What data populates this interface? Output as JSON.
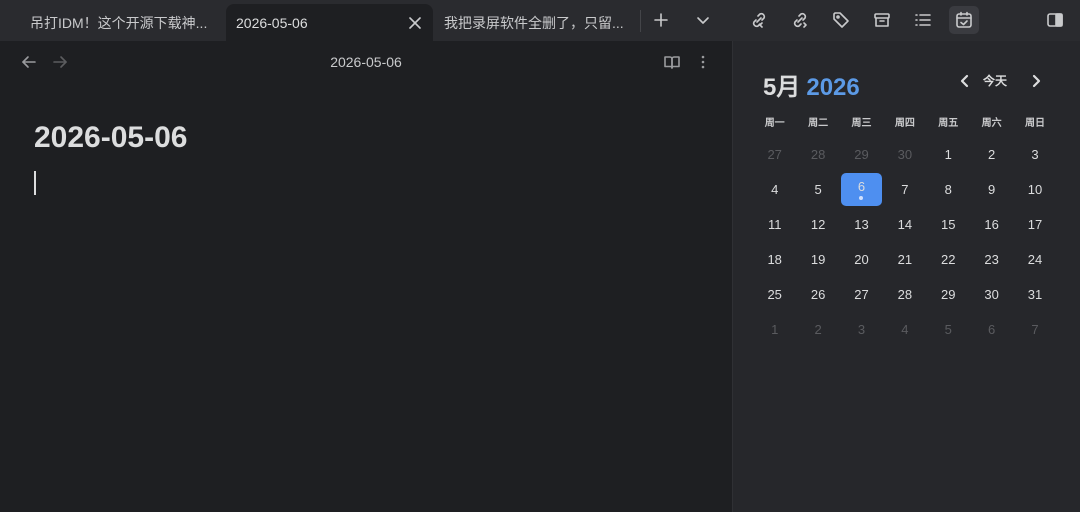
{
  "tabs": [
    {
      "label": "吊打IDM！这个开源下载神..."
    },
    {
      "label": "2026-05-06"
    },
    {
      "label": "我把录屏软件全删了，只留..."
    }
  ],
  "toolbar_icons": [
    "new-tab-icon",
    "tab-list-chevron-icon",
    "backlink-icon",
    "outgoing-link-icon",
    "tag-icon",
    "archive-icon",
    "outline-list-icon",
    "calendar-check-icon",
    "right-sidebar-toggle-icon"
  ],
  "editor": {
    "nav_title": "2026-05-06",
    "heading": "2026-05-06"
  },
  "calendar": {
    "month_label": "5月",
    "year_label": "2026",
    "today_label": "今天",
    "weekdays": [
      "周一",
      "周二",
      "周三",
      "周四",
      "周五",
      "周六",
      "周日"
    ],
    "days": [
      {
        "d": "27",
        "other": true
      },
      {
        "d": "28",
        "other": true
      },
      {
        "d": "29",
        "other": true
      },
      {
        "d": "30",
        "other": true
      },
      {
        "d": "1"
      },
      {
        "d": "2"
      },
      {
        "d": "3"
      },
      {
        "d": "4"
      },
      {
        "d": "5"
      },
      {
        "d": "6",
        "selected": true,
        "dot": true
      },
      {
        "d": "7"
      },
      {
        "d": "8"
      },
      {
        "d": "9"
      },
      {
        "d": "10"
      },
      {
        "d": "11"
      },
      {
        "d": "12"
      },
      {
        "d": "13"
      },
      {
        "d": "14"
      },
      {
        "d": "15"
      },
      {
        "d": "16"
      },
      {
        "d": "17"
      },
      {
        "d": "18"
      },
      {
        "d": "19"
      },
      {
        "d": "20"
      },
      {
        "d": "21"
      },
      {
        "d": "22"
      },
      {
        "d": "23"
      },
      {
        "d": "24"
      },
      {
        "d": "25"
      },
      {
        "d": "26"
      },
      {
        "d": "27"
      },
      {
        "d": "28"
      },
      {
        "d": "29"
      },
      {
        "d": "30"
      },
      {
        "d": "31"
      },
      {
        "d": "1",
        "other": true
      },
      {
        "d": "2",
        "other": true
      },
      {
        "d": "3",
        "other": true
      },
      {
        "d": "4",
        "other": true
      },
      {
        "d": "5",
        "other": true
      },
      {
        "d": "6",
        "other": true
      },
      {
        "d": "7",
        "other": true
      }
    ]
  },
  "colors": {
    "accent": "#4e8ff0",
    "year": "#5c9ae6",
    "background": "#1e1f22",
    "sidebar": "#26272b"
  }
}
